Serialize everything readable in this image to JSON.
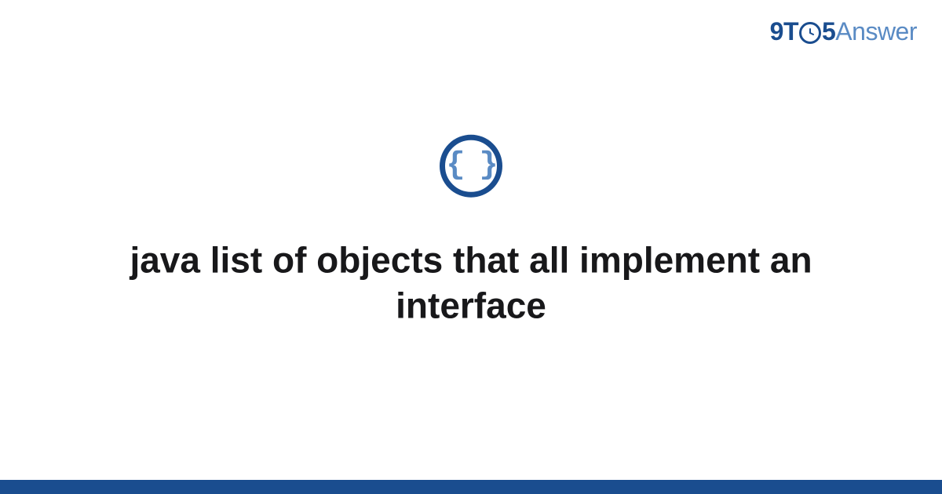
{
  "logo": {
    "part1": "9T",
    "clock": "⏱",
    "part2": "5",
    "part3": "Answer"
  },
  "icon": {
    "braces": "{ }"
  },
  "title": "java list of objects that all implement an interface"
}
